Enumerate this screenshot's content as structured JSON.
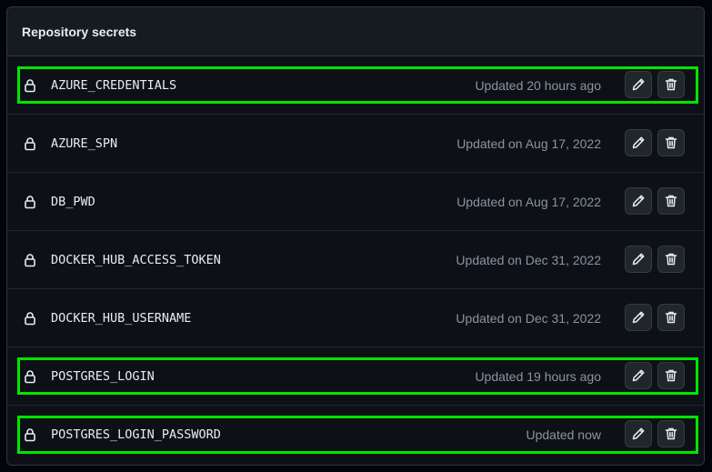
{
  "section_title": "Repository secrets",
  "icons": {
    "lock": "lock-icon",
    "edit": "pencil-icon",
    "delete": "trash-icon"
  },
  "colors": {
    "highlight": "#00e600",
    "background": "#0d1117",
    "text": "#e6edf3",
    "muted": "#8b949e"
  },
  "secrets": [
    {
      "name": "AZURE_CREDENTIALS",
      "updated": "Updated 20 hours ago",
      "highlighted": true
    },
    {
      "name": "AZURE_SPN",
      "updated": "Updated on Aug 17, 2022",
      "highlighted": false
    },
    {
      "name": "DB_PWD",
      "updated": "Updated on Aug 17, 2022",
      "highlighted": false
    },
    {
      "name": "DOCKER_HUB_ACCESS_TOKEN",
      "updated": "Updated on Dec 31, 2022",
      "highlighted": false
    },
    {
      "name": "DOCKER_HUB_USERNAME",
      "updated": "Updated on Dec 31, 2022",
      "highlighted": false
    },
    {
      "name": "POSTGRES_LOGIN",
      "updated": "Updated 19 hours ago",
      "highlighted": true
    },
    {
      "name": "POSTGRES_LOGIN_PASSWORD",
      "updated": "Updated now",
      "highlighted": true
    }
  ]
}
